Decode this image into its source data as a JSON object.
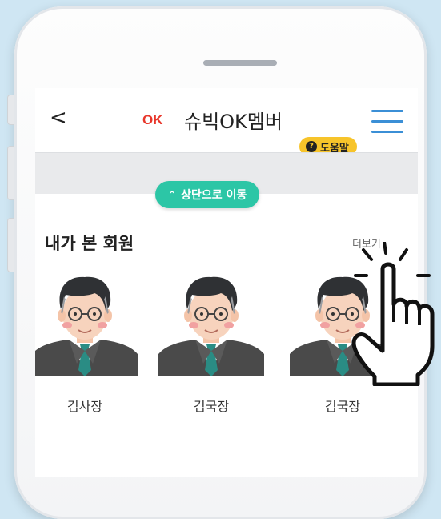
{
  "header": {
    "back_label": "<",
    "logo_text": "OK",
    "title": "슈빅OK멤버",
    "help_label": "도움말",
    "help_icon": "?"
  },
  "scroll_top_button": {
    "label": "상단으로 이동",
    "icon": "^"
  },
  "section": {
    "title_prefix": "내가 ",
    "title_highlight": "본 회원",
    "more_label": "더보기"
  },
  "members": [
    {
      "name": "김사장"
    },
    {
      "name": "김국장"
    },
    {
      "name": "김국장"
    }
  ],
  "colors": {
    "accent_teal": "#2cc6a6",
    "help_yellow": "#f7c42a",
    "logo_red": "#e8372b",
    "menu_blue": "#3b8fd6"
  }
}
